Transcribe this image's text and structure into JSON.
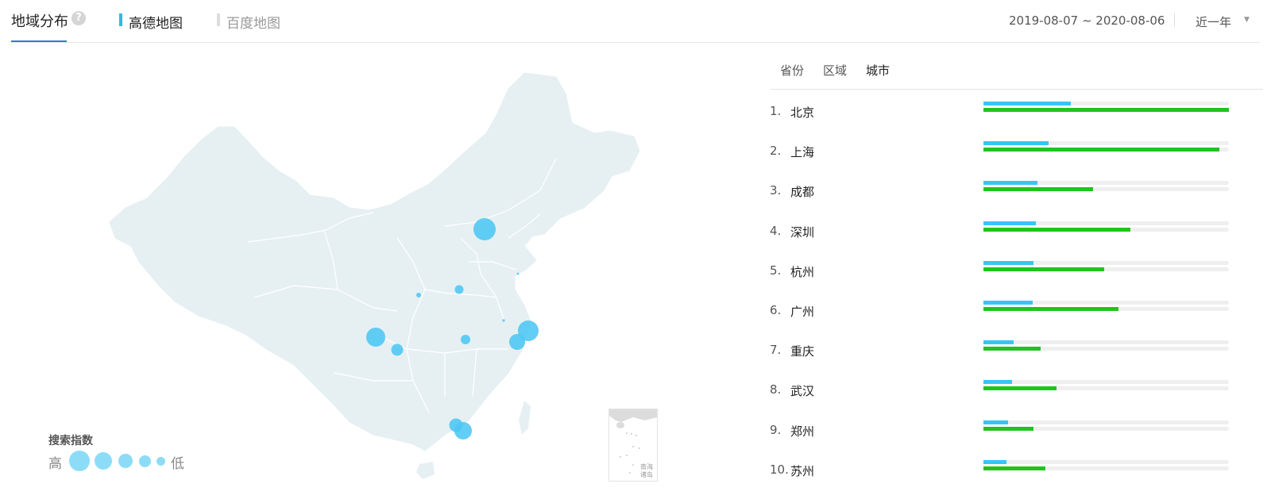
{
  "header": {
    "title": "地域分布",
    "help_icon": "question-circle-icon",
    "map_tabs": [
      {
        "label": "高德地图",
        "active": true,
        "color": "#33b6ea"
      },
      {
        "label": "百度地图",
        "active": false,
        "color": "#dddddd"
      }
    ],
    "date_range": "2019-08-07 ~ 2020-08-06",
    "period": "近一年",
    "period_icon": "caret-down-icon"
  },
  "map": {
    "legend_title": "搜索指数",
    "legend_high": "高",
    "legend_low": "低",
    "inset_label": "南海诸岛",
    "bubble_color": "#4cc6f4",
    "land_color": "#e6f0f3",
    "bubbles": [
      {
        "city": "北京",
        "size": "xl"
      },
      {
        "city": "上海",
        "size": "xl"
      },
      {
        "city": "成都",
        "size": "l"
      },
      {
        "city": "深圳",
        "size": "l"
      },
      {
        "city": "杭州",
        "size": "l"
      },
      {
        "city": "广州",
        "size": "l"
      },
      {
        "city": "重庆",
        "size": "m"
      },
      {
        "city": "武汉",
        "size": "m"
      },
      {
        "city": "郑州",
        "size": "m"
      },
      {
        "city": "苏州",
        "size": "s"
      },
      {
        "city": "西安",
        "size": "s"
      },
      {
        "city": "青岛",
        "size": "xs"
      }
    ]
  },
  "ranking": {
    "tabs": [
      {
        "label": "省份",
        "active": false
      },
      {
        "label": "区域",
        "active": false
      },
      {
        "label": "城市",
        "active": true
      }
    ],
    "colors": {
      "search": "#37c5f5",
      "total": "#1fc41f",
      "track": "#efefef"
    },
    "rows": [
      {
        "rank": "1.",
        "name": "北京",
        "blue": 0.356,
        "green": 1.0
      },
      {
        "rank": "2.",
        "name": "上海",
        "blue": 0.265,
        "green": 0.961
      },
      {
        "rank": "3.",
        "name": "成都",
        "blue": 0.22,
        "green": 0.447
      },
      {
        "rank": "4.",
        "name": "深圳",
        "blue": 0.214,
        "green": 0.599
      },
      {
        "rank": "5.",
        "name": "杭州",
        "blue": 0.204,
        "green": 0.492
      },
      {
        "rank": "6.",
        "name": "广州",
        "blue": 0.201,
        "green": 0.55
      },
      {
        "rank": "7.",
        "name": "重庆",
        "blue": 0.123,
        "green": 0.233
      },
      {
        "rank": "8.",
        "name": "武汉",
        "blue": 0.117,
        "green": 0.298
      },
      {
        "rank": "9.",
        "name": "郑州",
        "blue": 0.1,
        "green": 0.204
      },
      {
        "rank": "10.",
        "name": "苏州",
        "blue": 0.094,
        "green": 0.252
      }
    ]
  }
}
